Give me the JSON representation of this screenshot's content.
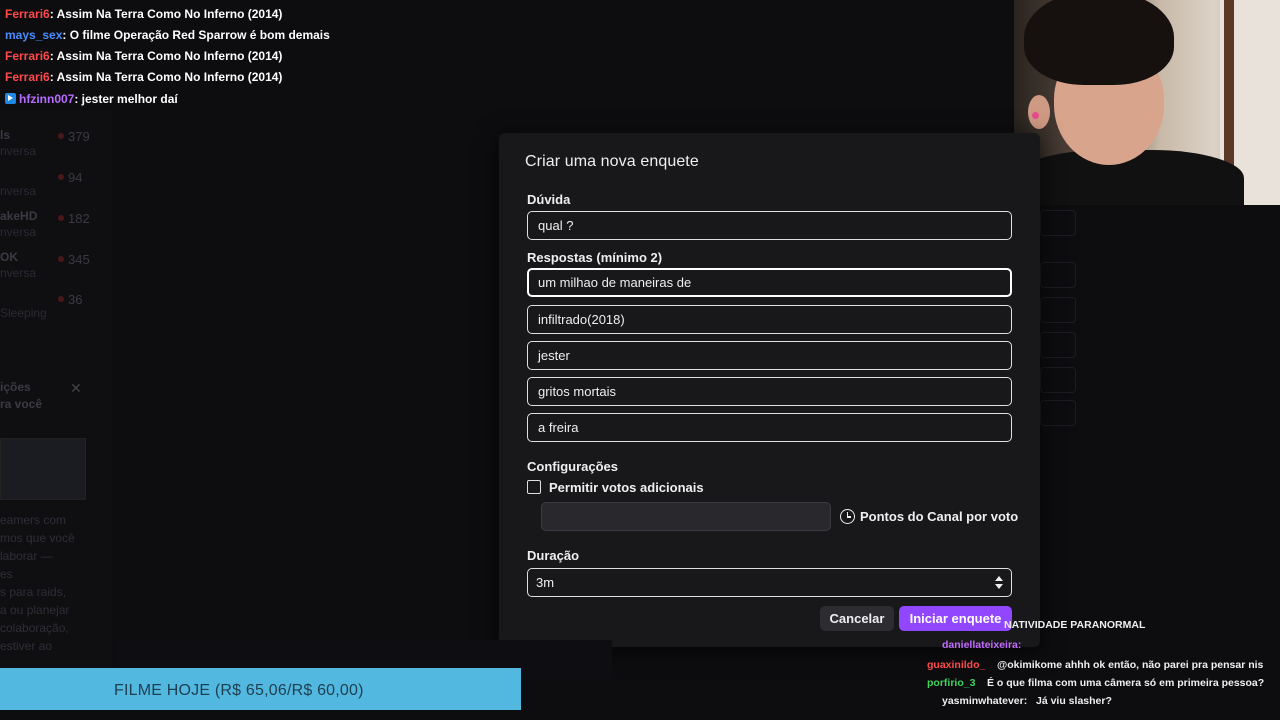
{
  "chat_overlay": [
    {
      "user": "Ferrari6",
      "color": "#ff4a4a",
      "msg": ": Assim Na Terra Como No Inferno (2014)",
      "badge": false
    },
    {
      "user": "mays_sex",
      "color": "#4a8cff",
      "msg": ": O filme Operação Red Sparrow é bom demais",
      "badge": false
    },
    {
      "user": "Ferrari6",
      "color": "#ff4a4a",
      "msg": ": Assim Na Terra Como No Inferno (2014)",
      "badge": false
    },
    {
      "user": "Ferrari6",
      "color": "#ff4a4a",
      "msg": ": Assim Na Terra Como No Inferno (2014)",
      "badge": false
    },
    {
      "user": "hfzinn007",
      "color": "#b86bff",
      "msg": ": jester melhor daí",
      "badge": true
    }
  ],
  "bg_sidebar": {
    "counts": [
      "379",
      "94",
      "182",
      "345",
      "36"
    ],
    "names": [
      "ls",
      "akeHD",
      "OK"
    ],
    "subs": [
      "nversa",
      "nversa",
      "nversa",
      "nversa",
      "Sleeping"
    ],
    "section_title_1": "ições",
    "section_title_2": "ra você",
    "body_lines": [
      "eamers com",
      "mos que você",
      "laborar —",
      "es",
      "s para raids,",
      "a ou planejar",
      "colaboração,",
      "estiver ao"
    ]
  },
  "modal": {
    "title": "Criar uma nova enquete",
    "question_label": "Dúvida",
    "question_value": "qual ?",
    "answers_label": "Respostas (mínimo 2)",
    "answers": [
      "um milhao de maneiras de",
      "infiltrado(2018)",
      "jester",
      "gritos mortais",
      "a freira"
    ],
    "settings_label": "Configurações",
    "allow_votes_label": "Permitir votos adicionais",
    "allow_votes_checked": false,
    "points_value": "",
    "points_label": "Pontos do Canal por voto",
    "duration_label": "Duração",
    "duration_value": "3m",
    "cancel_label": "Cancelar",
    "start_label": "Iniciar enquete",
    "accent": "#9147ff"
  },
  "bottom_chat": [
    {
      "user": "",
      "color": "#efeff1",
      "msg": "NATIVIDADE PARANORMAL"
    },
    {
      "user": "daniellateixeira:",
      "color": "#c06aff",
      "msg": ""
    },
    {
      "user": "guaxinildo_",
      "color": "#ff4a4a",
      "msg": "@okimikome ahhh ok então, não parei pra pensar nis"
    },
    {
      "user": "porfirio_3",
      "color": "#3fd35a",
      "msg": "É o que filma com uma câmera só em primeira pessoa?"
    },
    {
      "user": "yasminwhatever:",
      "color": "#efeff1",
      "msg": "Já viu slasher?"
    }
  ],
  "banner": {
    "text": "FILME HOJE (R$ 65,06/R$ 60,00)"
  }
}
